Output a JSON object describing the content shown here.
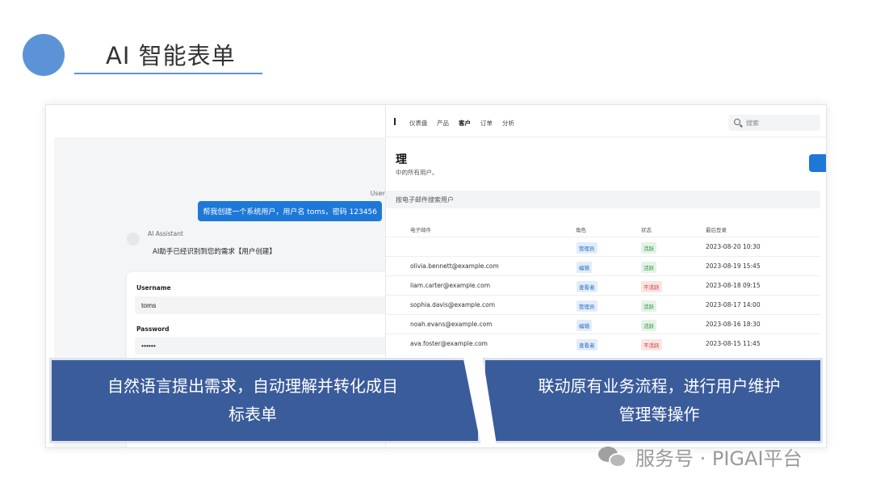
{
  "header": {
    "title": "AI 智能表单"
  },
  "chat": {
    "user_label": "User",
    "user_message": "帮我创建一个系统用户，用户名 toms，密码 123456",
    "ai_name": "AI Assistant",
    "ai_message": "AI助手已经识别到您的需求【用户创建】",
    "form": {
      "username_label": "Username",
      "username_value": "toms",
      "password_label": "Password",
      "password_value": "••••••"
    }
  },
  "admin": {
    "nav": [
      "仪表盘",
      "产品",
      "客户",
      "订单",
      "分析"
    ],
    "nav_active": "客户",
    "search_placeholder": "搜索",
    "page_title": "理",
    "page_subtitle": "中的所有用户。",
    "table_search_placeholder": "按电子邮件搜索用户",
    "columns": [
      "电子邮件",
      "角色",
      "状态",
      "最后登录"
    ],
    "rows": [
      {
        "email": "",
        "role": "管理员",
        "status": "活跃",
        "status_type": "active",
        "last_login": "2023-08-20 10:30"
      },
      {
        "email": "olivia.bennett@example.com",
        "role": "编辑",
        "status": "活跃",
        "status_type": "active",
        "last_login": "2023-08-19 15:45"
      },
      {
        "email": "liam.carter@example.com",
        "role": "查看者",
        "status": "不活跃",
        "status_type": "inactive",
        "last_login": "2023-08-18 09:15"
      },
      {
        "email": "sophia.davis@example.com",
        "role": "管理员",
        "status": "活跃",
        "status_type": "active",
        "last_login": "2023-08-17 14:00"
      },
      {
        "email": "noah.evans@example.com",
        "role": "编辑",
        "status": "活跃",
        "status_type": "active",
        "last_login": "2023-08-16 18:30"
      },
      {
        "email": "ava.foster@example.com",
        "role": "查看者",
        "status": "不活跃",
        "status_type": "inactive",
        "last_login": "2023-08-15 11:45"
      }
    ]
  },
  "captions": {
    "left_line1": "自然语言提出需求，自动理解并转化成目",
    "left_line2": "标表单",
    "right_line1": "联动原有业务流程，进行用户维护",
    "right_line2": "管理等操作"
  },
  "watermark": {
    "text": "服务号 · PIGAI平台"
  },
  "colors": {
    "accent": "#5b93d6",
    "caption_bg": "#3b5c9b",
    "primary_button": "#1d78d8"
  }
}
